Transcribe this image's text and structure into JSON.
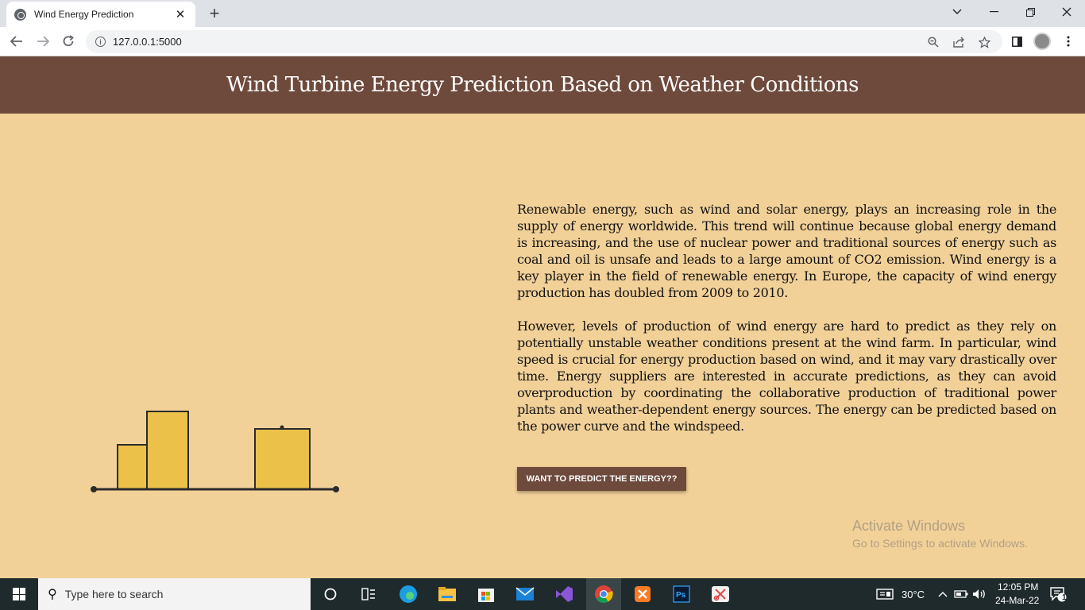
{
  "browser": {
    "tab_title": "Wind Energy Prediction",
    "tab_close": "✕",
    "new_tab": "+",
    "url": "127.0.0.1:5000",
    "info_glyph": "i",
    "icons": [
      "globe-icon",
      "close-icon",
      "plus-icon",
      "chevron-down-icon",
      "minimize-icon",
      "restore-icon",
      "close-window-icon",
      "back-arrow-icon",
      "forward-arrow-icon",
      "reload-icon",
      "info-icon",
      "zoom-icon",
      "share-icon",
      "star-icon",
      "sidebar-icon",
      "avatar",
      "kebab-menu-icon"
    ]
  },
  "page": {
    "title": "Wind Turbine Energy Prediction Based on Weather Conditions",
    "paragraphs": [
      "Renewable energy, such as wind and solar energy, plays an increasing role in the supply of energy worldwide. This trend will continue because global energy demand is increasing, and the use of nuclear power and traditional sources of energy such as coal and oil is unsafe and leads to a large amount of CO2 emission. Wind energy is a key player in the field of renewable energy. In Europe, the capacity of wind energy production has doubled from 2009 to 2010.",
      "However, levels of production of wind energy are hard to predict as they rely on potentially unstable weather conditions present at the wind farm. In particular, wind speed is crucial for energy production based on wind, and it may vary drastically over time. Energy suppliers are interested in accurate predictions, as they can avoid overproduction by coordinating the collaborative production of traditional power plants and weather-dependent energy sources. The energy can be predicted based on the power curve and the windspeed."
    ],
    "cta_label": "WANT TO PREDICT THE ENERGY??",
    "colors": {
      "header": "#6e4a3c",
      "background": "#f2d199",
      "bar_fill": "#ecc14a",
      "bar_stroke": "#2b2b2b"
    }
  },
  "watermark": {
    "title": "Activate Windows",
    "subtitle": "Go to Settings to activate Windows."
  },
  "taskbar": {
    "search_placeholder": "Type here to search",
    "temperature": "30°C",
    "time": "12:05 PM",
    "date": "24-Mar-22",
    "notification_count": "1"
  }
}
